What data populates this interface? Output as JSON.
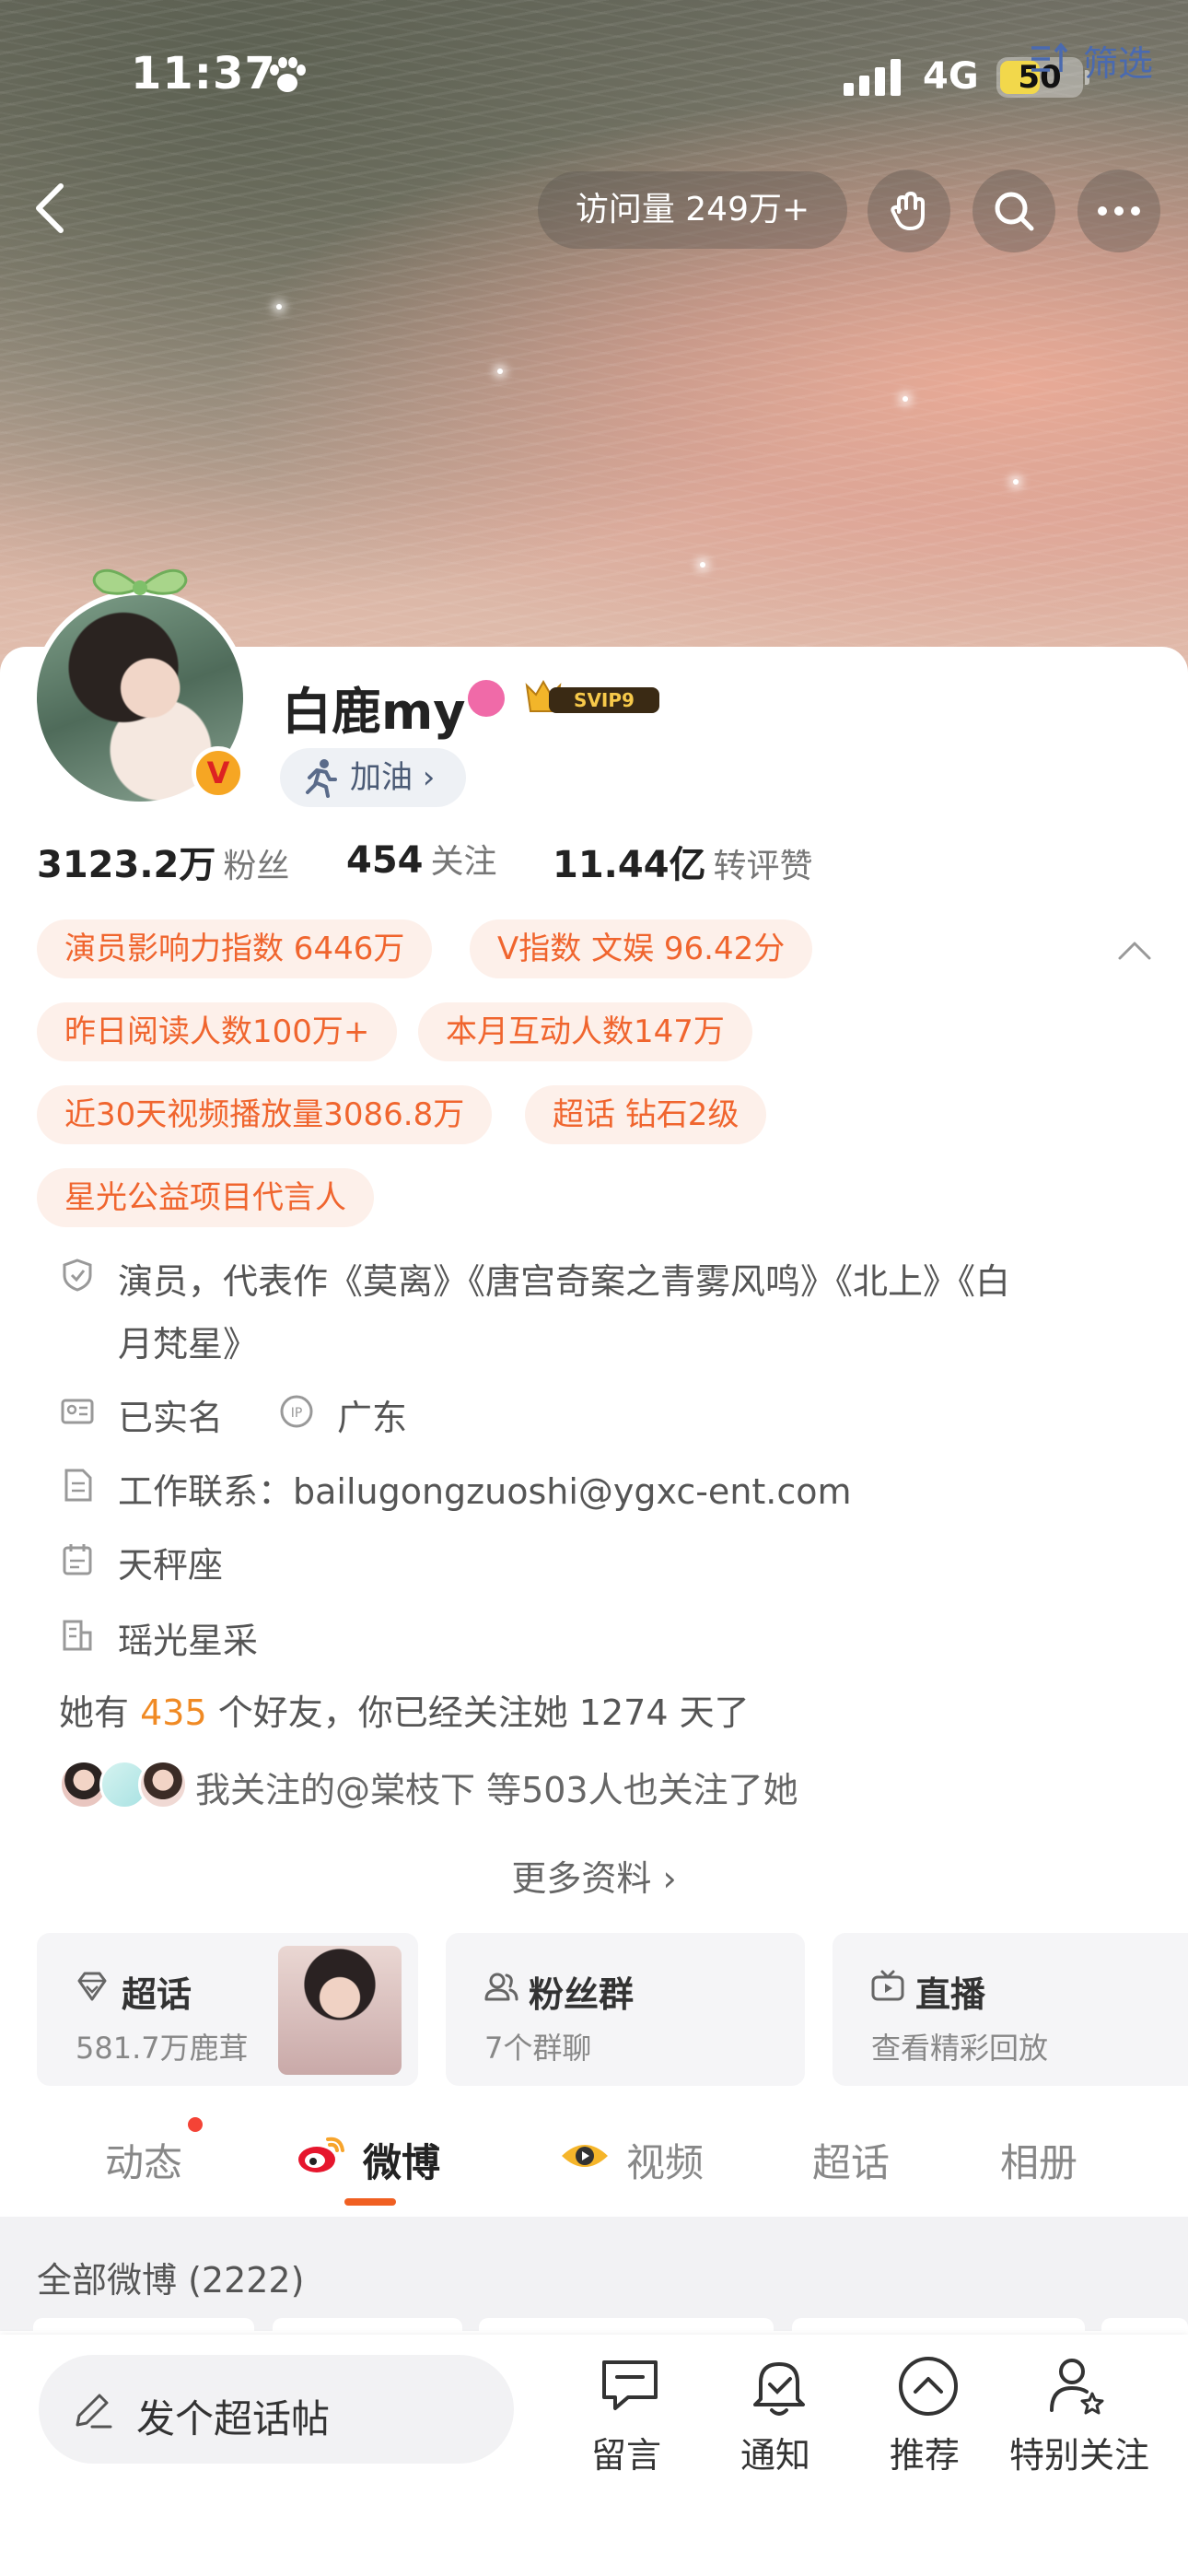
{
  "status_bar": {
    "time": "11:37",
    "network": "4G",
    "battery": "50",
    "battery_level": 0.5
  },
  "top_nav": {
    "visits": "访问量 249万+"
  },
  "profile": {
    "name": "白鹿my",
    "svip": "SVIP9",
    "cheer_label": "加油",
    "stats": [
      {
        "value": "3123.2万",
        "label": "粉丝"
      },
      {
        "value": "454",
        "label": "关注"
      },
      {
        "value": "11.44亿",
        "label": "转评赞"
      }
    ],
    "tags": [
      "演员影响力指数 6446万",
      "V指数 文娱 96.42分",
      "昨日阅读人数100万+",
      "本月互动人数147万",
      "近30天视频播放量3086.8万",
      "超话 钻石2级",
      "星光公益项目代言人"
    ],
    "bio_line1": "演员，代表作《莫离》《唐宫奇案之青雾风鸣》《北上》《白",
    "bio_line2": "月梵星》",
    "verified": "已实名",
    "ip": "广东",
    "contact": "工作联系：bailugongzuoshi@ygxc-ent.com",
    "zodiac": "天秤座",
    "company": "瑶光星采",
    "friends_prefix": "她有 ",
    "friends_count": "435",
    "friends_suffix": " 个好友，你已经关注她 1274 天了",
    "followers_line": "我关注的@棠枝下  等503人也关注了她",
    "more_info": "更多资料 ›"
  },
  "features": [
    {
      "title": "超话",
      "sub": "581.7万鹿茸"
    },
    {
      "title": "粉丝群",
      "sub": "7个群聊"
    },
    {
      "title": "直播",
      "sub": "查看精彩回放"
    }
  ],
  "tabs": [
    "动态",
    "微博",
    "视频",
    "超话",
    "相册"
  ],
  "filter": {
    "left": "全部微博 (2222)",
    "right": "筛选"
  },
  "bottom": {
    "compose": "发个超话帖",
    "items": [
      "留言",
      "通知",
      "推荐",
      "特别关注"
    ]
  },
  "colors": {
    "accent": "#f06022",
    "tag_text": "#f0652e",
    "tag_bg": "#fdf0ea",
    "link": "#4a6ab0",
    "highlight": "#f08a24"
  }
}
